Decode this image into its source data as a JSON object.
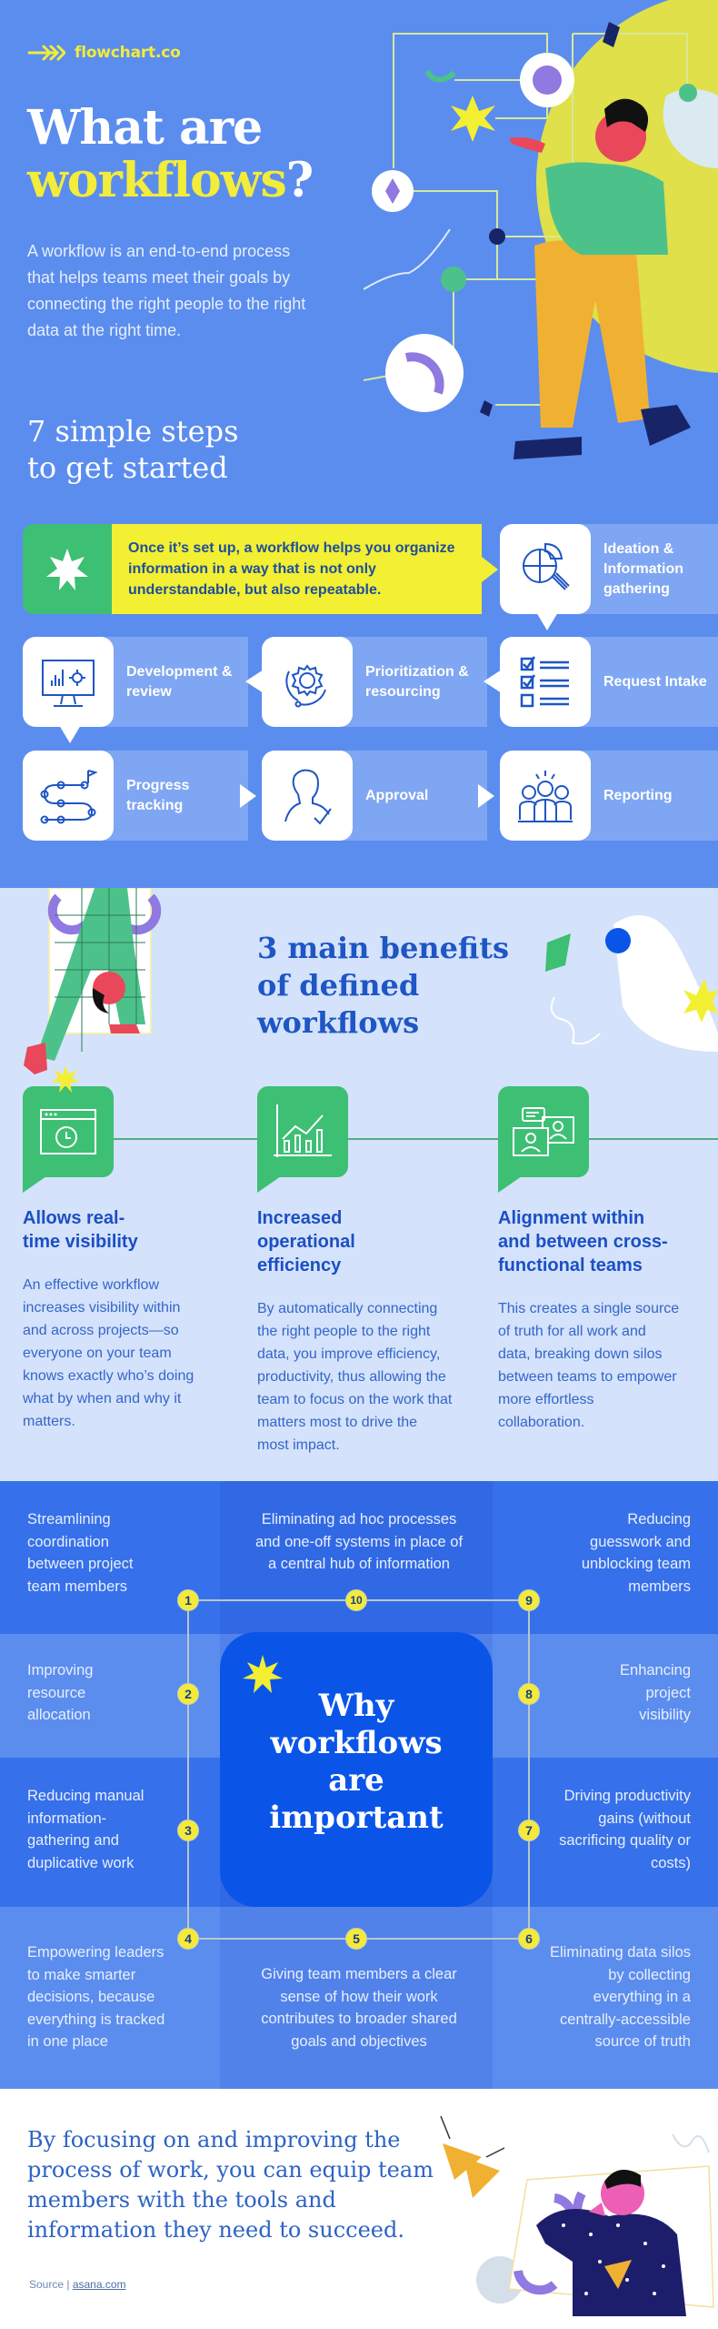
{
  "brand": {
    "name": "flowchart.co",
    "icon": "triple-arrow-icon"
  },
  "hero": {
    "title_line1": "What are",
    "title_line2_highlight": "workflows",
    "title_line2_suffix": "?",
    "description": "A workflow is an end-to-end process that helps teams meet their goals by connecting the right people to the right data at the right time."
  },
  "steps": {
    "title_line1": "7 simple steps",
    "title_line2": "to get started",
    "intro": "Once it’s set up, a workflow helps you organize information in a way that is not only understandable, but also repeatable.",
    "items": [
      {
        "label": "Ideation & Information gathering",
        "icon": "puzzle-bulb-icon"
      },
      {
        "label": "Request Intake",
        "icon": "checklist-icon"
      },
      {
        "label": "Prioritization & resourcing",
        "icon": "gear-cycle-icon"
      },
      {
        "label": "Development & review",
        "icon": "monitor-chart-icon"
      },
      {
        "label": "Progress tracking",
        "icon": "roadmap-flag-icon"
      },
      {
        "label": "Approval",
        "icon": "person-check-icon"
      },
      {
        "label": "Reporting",
        "icon": "team-idea-icon"
      }
    ]
  },
  "benefits": {
    "title_line1": "3 main benefits",
    "title_line2": "of defined",
    "title_line3": "workflows",
    "items": [
      {
        "heading": "Allows real-time visibility",
        "body": "An effective workflow increases visibility within and across projects—so everyone on your team knows exactly who’s doing what by when and why it matters.",
        "icon": "browser-clock-icon"
      },
      {
        "heading": "Increased operational efficiency",
        "body": "By automatically connecting the right people to the right data, you improve efficiency, productivity, thus allowing the team to focus on the work that matters most to drive the most impact.",
        "icon": "growth-chart-icon"
      },
      {
        "heading": "Alignment within and between cross-functional teams",
        "body": "This creates a single source of truth for all work and data, breaking down silos between teams to empower more effortless collaboration.",
        "icon": "video-call-icon"
      }
    ]
  },
  "why": {
    "title": "Why workflows are important",
    "reasons": [
      {
        "num": "1",
        "text": "Streamlining coordination between project team members"
      },
      {
        "num": "2",
        "text": "Improving resource allocation"
      },
      {
        "num": "3",
        "text": "Reducing manual information-gathering and duplicative work"
      },
      {
        "num": "4",
        "text": "Empowering leaders to make smarter decisions, because everything is tracked in one place"
      },
      {
        "num": "5",
        "text": "Giving team members a clear sense of how their work contributes to broader shared goals and objectives"
      },
      {
        "num": "6",
        "text": "Eliminating data silos by collecting everything in a centrally-accessible source of truth"
      },
      {
        "num": "7",
        "text": "Driving productivity gains (without sacrificing quality or costs)"
      },
      {
        "num": "8",
        "text": "Enhancing project visibility"
      },
      {
        "num": "9",
        "text": "Reducing guesswork and unblocking team members"
      },
      {
        "num": "10",
        "text": "Eliminating ad hoc processes and one-off systems in place of a central hub of information"
      }
    ]
  },
  "footer": {
    "closing": "By focusing on and improving the process of work, you can equip team members with the tools and information they need to succeed.",
    "source_label": "Source",
    "source_link": "asana.com"
  },
  "colors": {
    "hero_bg": "#5b8def",
    "accent_yellow": "#f3ef32",
    "accent_green": "#3dbf74",
    "benefits_bg": "#d4e2fb",
    "why_center": "#0a55e8",
    "text_blue": "#1e56c4"
  }
}
